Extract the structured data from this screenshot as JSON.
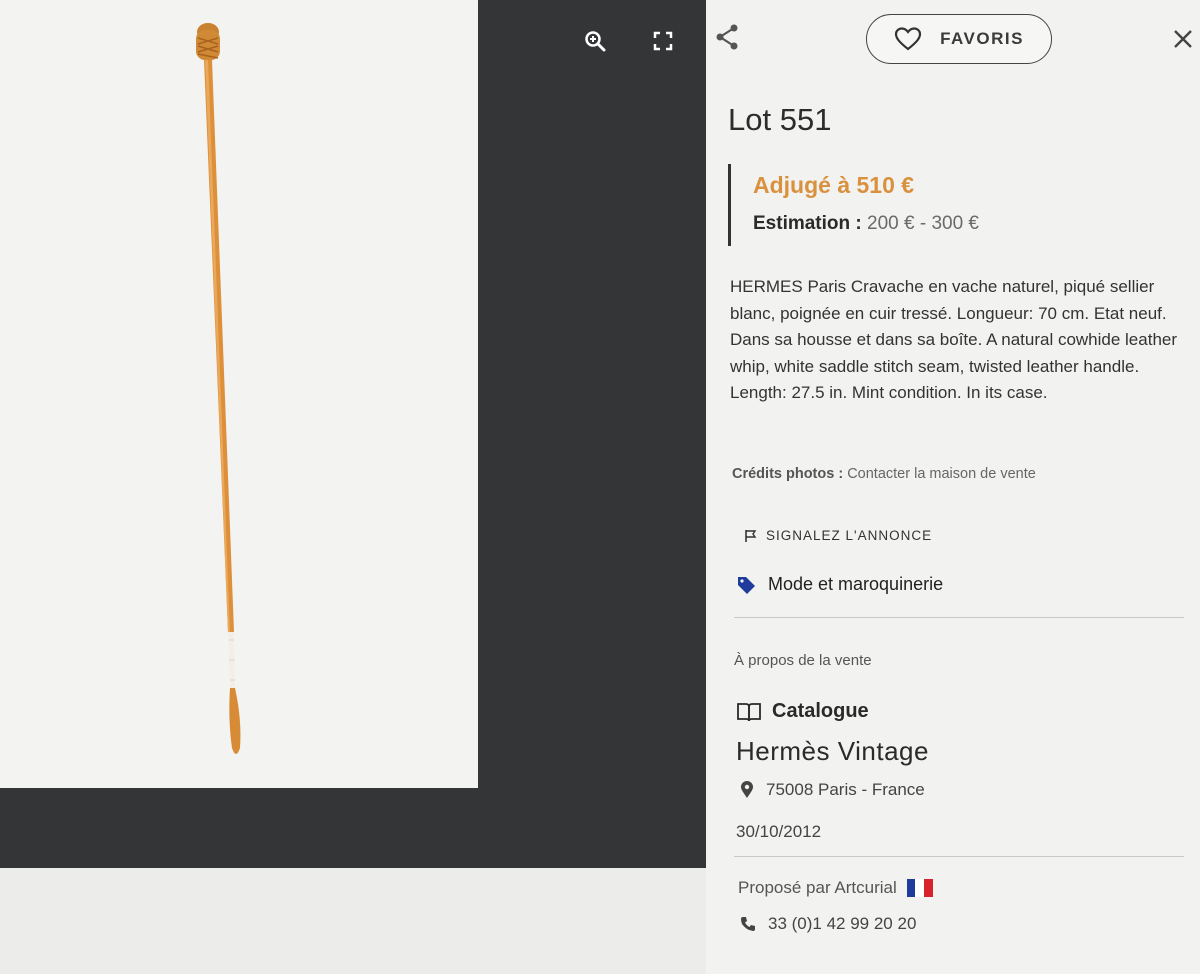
{
  "lot": {
    "title": "Lot 551"
  },
  "price": {
    "sold": "Adjugé à 510 €",
    "estimate_label": "Estimation :",
    "estimate_value": "200 € - 300 €"
  },
  "description": "HERMES Paris Cravache en vache naturel, piqué sellier blanc, poignée en cuir tressé. Longueur: 70 cm. Etat neuf. Dans sa housse et dans sa boîte. A natural cowhide leather whip, white saddle stitch seam, twisted leather handle. Length: 27.5 in. Mint condition. In its case.",
  "credits": {
    "label": "Crédits photos :",
    "value": "Contacter la maison de vente"
  },
  "actions": {
    "favorite_label": "FAVORIS",
    "report_label": "SIGNALEZ L'ANNONCE"
  },
  "category": "Mode et maroquinerie",
  "sale": {
    "about_label": "À propos de la vente",
    "catalogue_label": "Catalogue",
    "name": "Hermès Vintage",
    "location": "75008 Paris - France",
    "date": "30/10/2012",
    "offered_by": "Proposé par Artcurial",
    "phone": "33 (0)1 42 99 20 20"
  },
  "icons": {
    "zoom": "zoom-in-icon",
    "fullscreen": "fullscreen-icon",
    "share": "share-icon",
    "heart": "heart-icon",
    "close": "close-icon",
    "flag": "flag-icon",
    "tag": "tag-icon",
    "book": "book-icon",
    "pin": "map-pin-icon",
    "phone": "phone-icon"
  },
  "colors": {
    "sold_accent": "#d9913e",
    "tag_icon": "#1f3c9c",
    "viewer_bg": "#333536",
    "flag_blue": "#1f3c9c",
    "flag_red": "#d6232d"
  }
}
